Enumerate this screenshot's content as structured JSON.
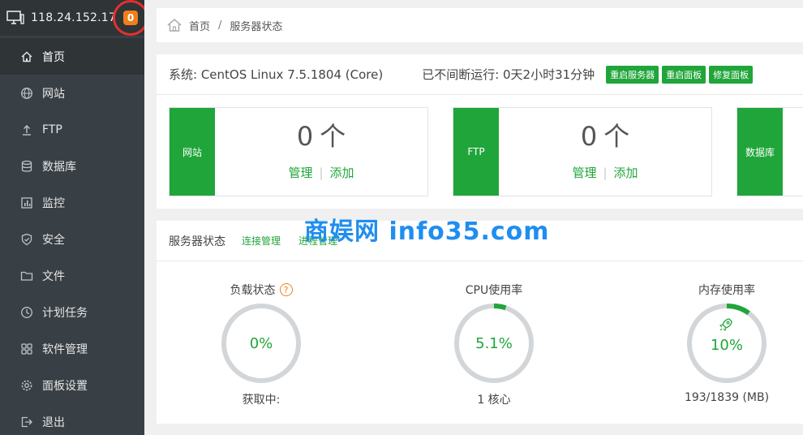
{
  "sidebar": {
    "ip": "118.24.152.17",
    "badge": "0",
    "items": [
      {
        "label": "首页"
      },
      {
        "label": "网站"
      },
      {
        "label": "FTP"
      },
      {
        "label": "数据库"
      },
      {
        "label": "监控"
      },
      {
        "label": "安全"
      },
      {
        "label": "文件"
      },
      {
        "label": "计划任务"
      },
      {
        "label": "软件管理"
      },
      {
        "label": "面板设置"
      },
      {
        "label": "退出"
      }
    ]
  },
  "breadcrumb": {
    "home": "首页",
    "separator": "/",
    "current": "服务器状态"
  },
  "system": {
    "os": "系统: CentOS Linux 7.5.1804 (Core)",
    "uptime": "已不间断运行: 0天2小时31分钟",
    "buttons": [
      "重启服务器",
      "重启面板",
      "修复面板"
    ]
  },
  "stats": [
    {
      "label": "网站",
      "count": "0",
      "unit": "个",
      "manage": "管理",
      "divider": "|",
      "add": "添加"
    },
    {
      "label": "FTP",
      "count": "0",
      "unit": "个",
      "manage": "管理",
      "divider": "|",
      "add": "添加"
    },
    {
      "label": "数据库"
    }
  ],
  "server_status": {
    "title": "服务器状态",
    "links": [
      "连接管理",
      "进程管理"
    ],
    "watermark": "商娱网 info35.com",
    "gauges": [
      {
        "title": "负载状态",
        "help": "?",
        "value": "0%",
        "fraction": 0.0,
        "sub": "获取中:"
      },
      {
        "title": "CPU使用率",
        "value": "5.1%",
        "fraction": 0.051,
        "sub": "1 核心"
      },
      {
        "title": "内存使用率",
        "value": "10%",
        "fraction": 0.1,
        "sub": "193/1839 (MB)"
      }
    ]
  },
  "colors": {
    "accent": "#20a53a",
    "sidebar_bg": "#394045",
    "badge": "#ef7f1a",
    "highlight_circle": "#e3302e",
    "ring_track": "#d3d6d9"
  }
}
